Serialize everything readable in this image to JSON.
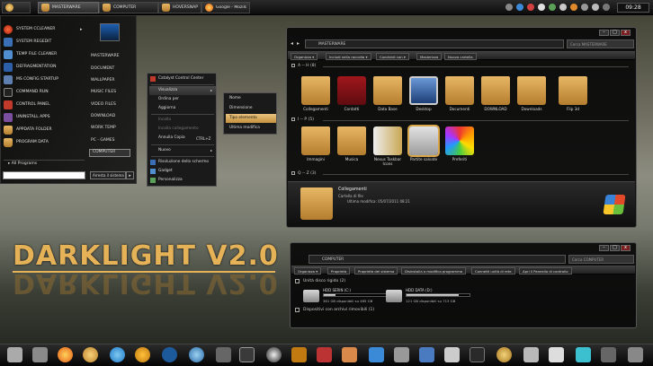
{
  "colors": {
    "accent": "#e6b258",
    "selection": "#d9a64a"
  },
  "topbar": {
    "tasks": [
      {
        "label": "",
        "icon": "start-orb-icon",
        "active": false
      },
      {
        "label": "MASTERWARE",
        "icon": "folder-icon",
        "active": true
      },
      {
        "label": "COMPUTER",
        "icon": "folder-icon",
        "active": false
      },
      {
        "label": "HOVERSNAP",
        "icon": "folder-icon",
        "active": false
      },
      {
        "label": "Google - Mozilla ...",
        "icon": "firefox-icon",
        "active": false
      }
    ],
    "clock": "09:28"
  },
  "start_menu": {
    "items": [
      "SYSTEM CCLEANER",
      "SYSTEM REGEDIT",
      "TEMP FILE CLEANER",
      "DEFRAGMENTATION",
      "MS CONFIG STARTUP",
      "COMMAND RUN",
      "CONTROL PANEL",
      "UNINSTALL APPS",
      "APPDATA FOLDER",
      "PROGRAM DATA"
    ],
    "all_programs": "All Programs",
    "right_items": [
      "MASTERWARE",
      "DOCUMENT",
      "WALLPAPER",
      "MUSIC FILES",
      "VIDEO FILES",
      "DOWNLOAD",
      "WORK TEMP",
      "PC - GAMES",
      "COMPUTER"
    ],
    "shutdown": "Arresta il sistema",
    "shutdown_arrow": "▸"
  },
  "context_menu": {
    "items": [
      {
        "label": "Catalyst Control Center",
        "type": "item"
      },
      {
        "label": "Visualizza",
        "type": "highlight"
      },
      {
        "label": "Ordina per",
        "type": "item"
      },
      {
        "label": "Aggiorna",
        "type": "item"
      },
      {
        "label": "Incolla",
        "type": "disabled"
      },
      {
        "label": "Incolla collegamento",
        "type": "disabled"
      },
      {
        "label": "Annulla Copia",
        "shortcut": "CTRL+Z",
        "type": "item"
      },
      {
        "label": "Nuovo",
        "type": "item"
      },
      {
        "label": "Risoluzione dello schermo",
        "type": "item"
      },
      {
        "label": "Gadget",
        "type": "item"
      },
      {
        "label": "Personalizza",
        "type": "item"
      }
    ],
    "submenu": [
      "Nome",
      "Dimensione",
      "Tipo elemento",
      "Ultima modifica"
    ],
    "submenu_selected": "Tipo elemento"
  },
  "explorer1": {
    "address": "MASTERWARE",
    "search_placeholder": "Cerca MASTERWARE",
    "toolbar": [
      "Organizza ▾",
      "Includi nella raccolta ▾",
      "Condividi con ▾",
      "Masterizza",
      "Nuova cartella"
    ],
    "groups": [
      {
        "title": "A -- H (8)",
        "items": [
          "Collegamenti",
          "Contatti",
          "Data Base",
          "Desktop",
          "Documenti",
          "DOWNLOAD",
          "Downloads",
          "Flip 3d"
        ]
      },
      {
        "title": "I -- P (5)",
        "items": [
          "Immagini",
          "Musica",
          "Nexus Taskbar Icons",
          "Partite salvate",
          "Preferiti"
        ]
      },
      {
        "title": "Q -- Z (3)",
        "items": []
      }
    ],
    "details": {
      "name": "Collegamenti",
      "type": "Cartella di file",
      "modified": "Ultima modifica: 05/07/2011 08:21"
    }
  },
  "explorer2": {
    "address": "COMPUTER",
    "search_placeholder": "Cerca COMPUTER",
    "toolbar": [
      "Organizza ▾",
      "Proprietà",
      "Proprietà del sistema",
      "Disinstalla o modifica programma",
      "Connetti unità di rete",
      "Apri il Pannello di controllo"
    ],
    "section1": "Unità disco rigido (2)",
    "drives": [
      {
        "name": "HDD SERIN (C:)",
        "free": "381 GB disponibili su 465 GB",
        "used": 0.18
      },
      {
        "name": "HDD DATA (D:)",
        "free": "121 GB disponibili su 713 GB",
        "used": 0.83
      }
    ],
    "section2": "Dispositivi con archivi rimovibili (1)"
  },
  "logo": {
    "text": "DARKLIGHT V2.0"
  }
}
